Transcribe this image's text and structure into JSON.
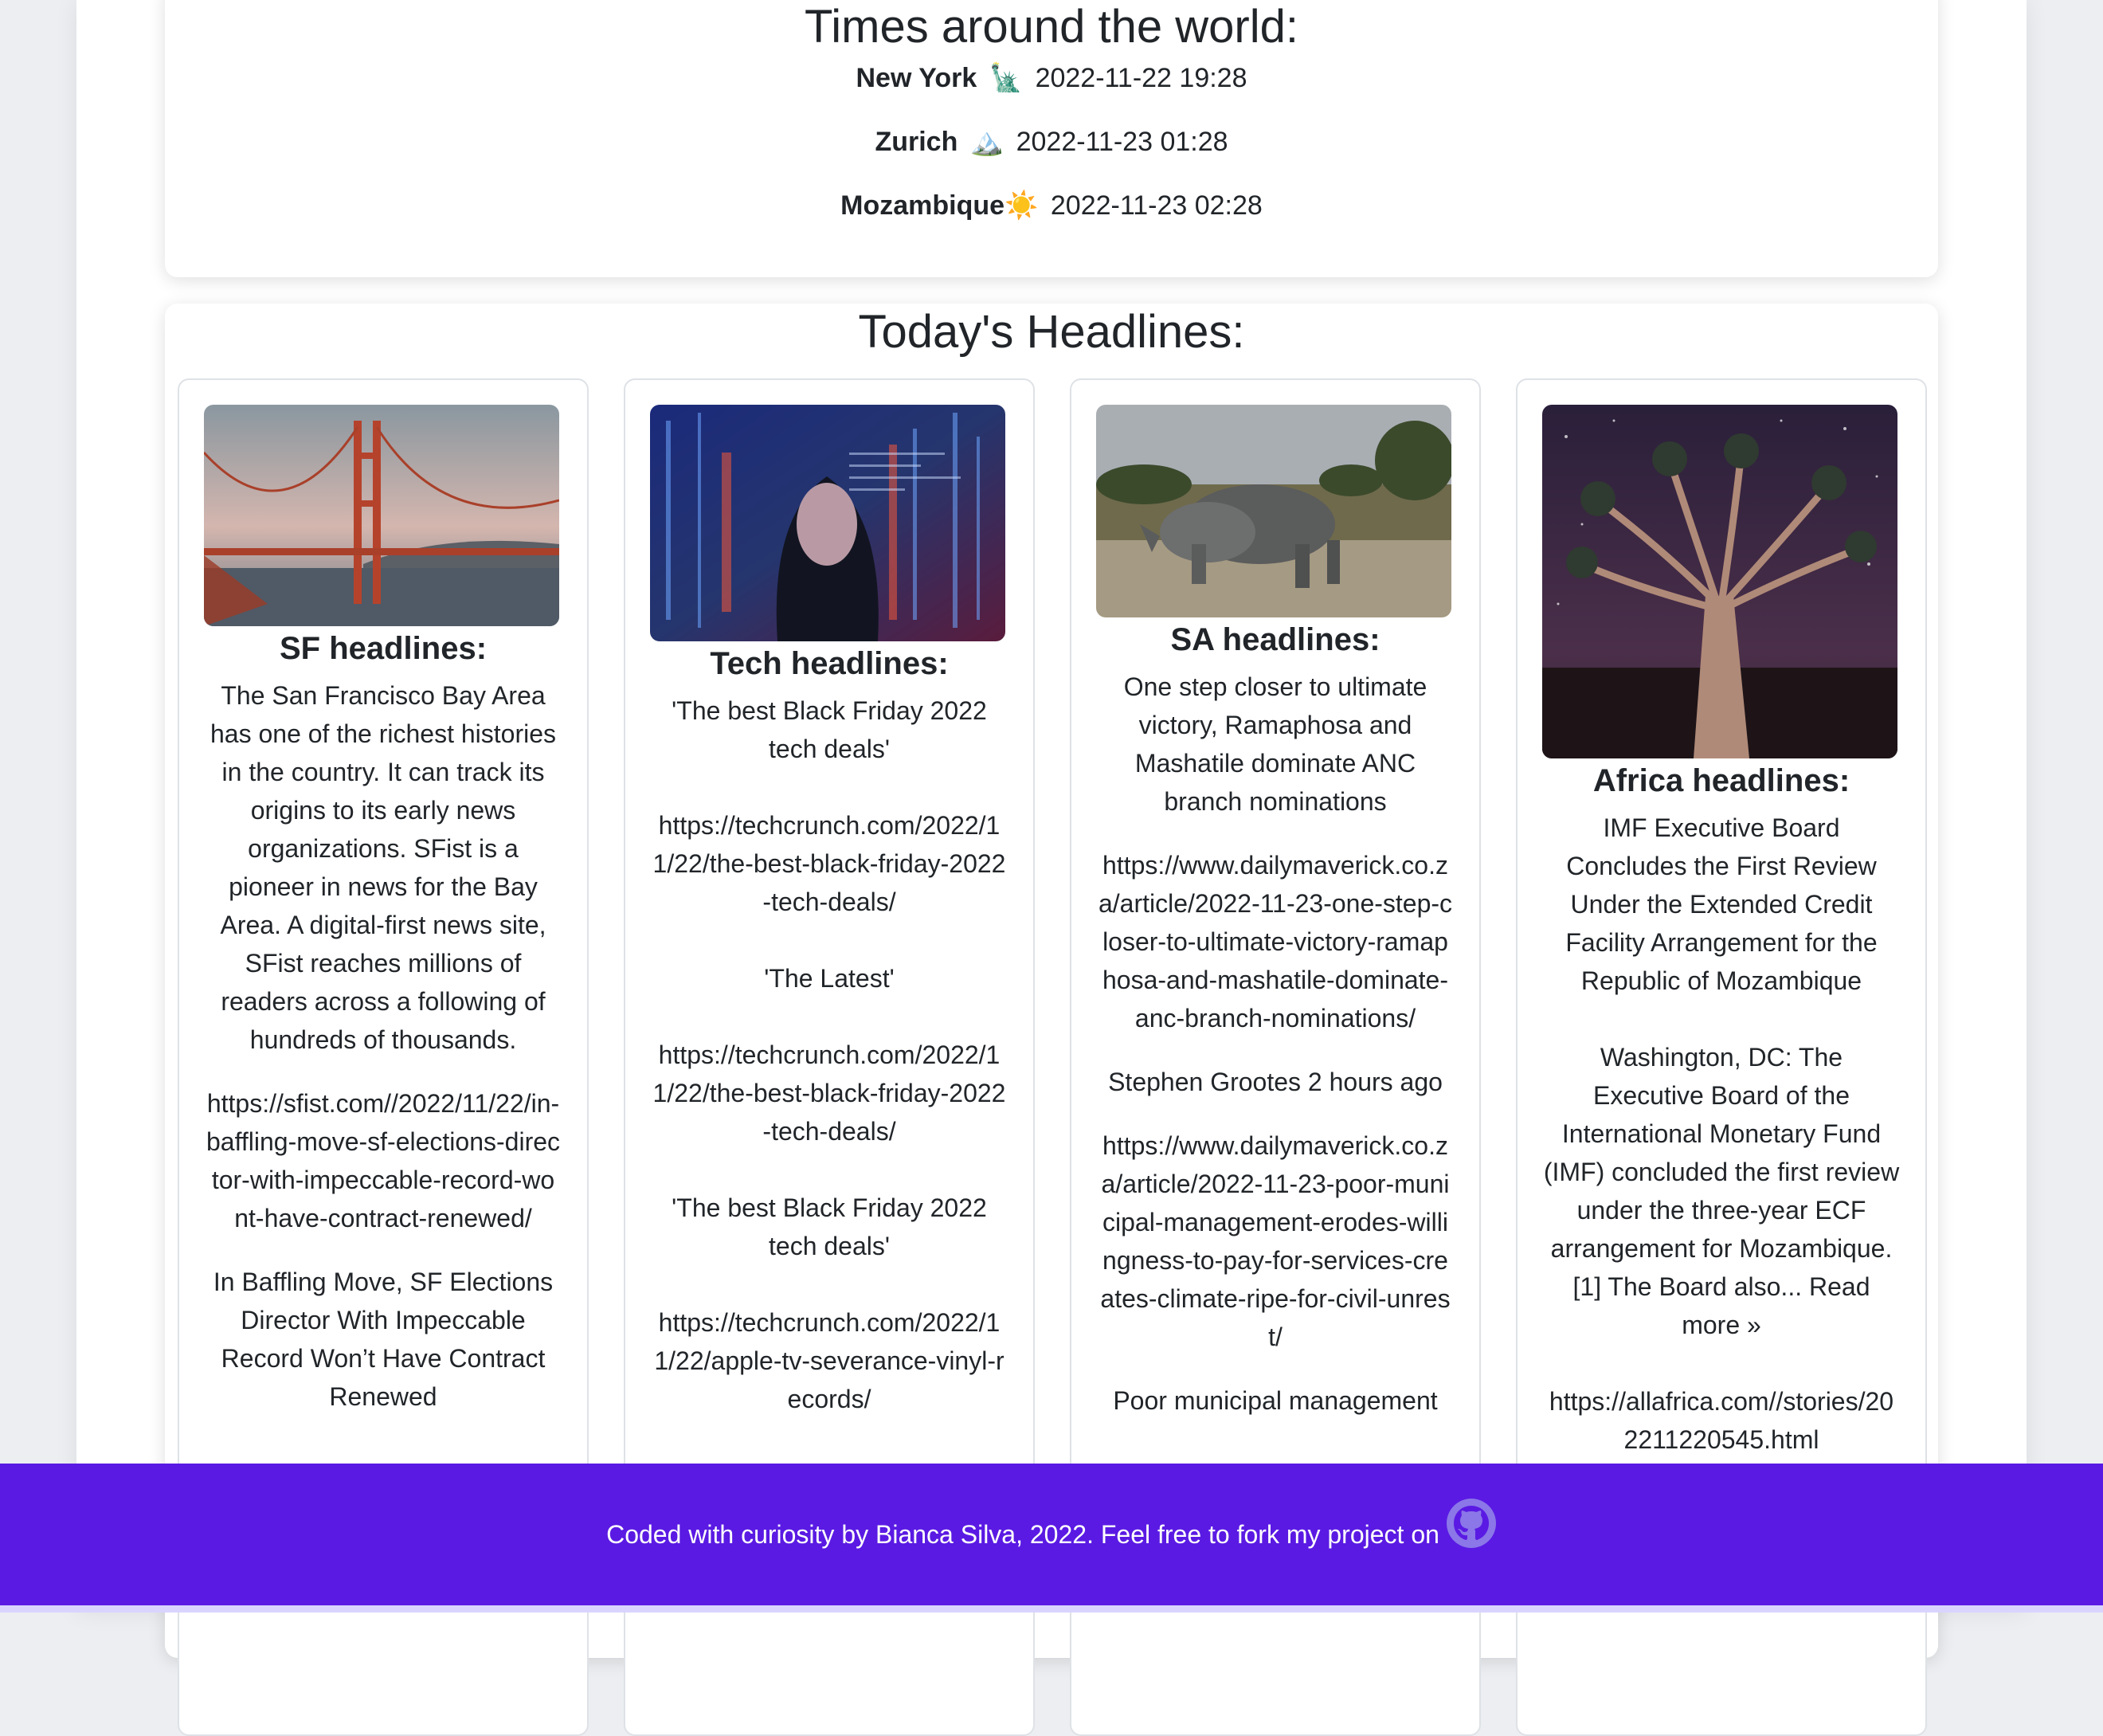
{
  "times": {
    "title": "Times around the world:",
    "rows": [
      {
        "city": "New York",
        "emoji": "🗽",
        "datetime": "2022-11-22 19:28"
      },
      {
        "city": "Zurich",
        "emoji": "🏔️",
        "datetime": "2022-11-23 01:28"
      },
      {
        "city": "Mozambique",
        "emoji": "☀️",
        "datetime": "2022-11-23 02:28"
      }
    ]
  },
  "headlines": {
    "title": "Today's Headlines:",
    "cards": [
      {
        "title": "SF headlines:",
        "image": "golden-gate-bridge-image",
        "paragraphs": [
          "The San Francisco Bay Area has one of the richest histories in the country. It can track its origins to its early news organizations. SFist is a pioneer in news for the Bay Area. A digital-first news site, SFist reaches millions of readers across a following of hundreds of thousands.",
          "https://sfist.com//2022/11/22/in-baffling-move-sf-elections-director-with-impeccable-record-wont-have-contract-renewed/",
          "In Baffling Move, SF Elections Director With Impeccable Record Won’t Have Contract Renewed"
        ]
      },
      {
        "title": "Tech headlines:",
        "image": "tech-person-code-image",
        "paragraphs": [
          "'The best Black Friday 2022 tech deals'",
          "https://techcrunch.com/2022/11/22/the-best-black-friday-2022-tech-deals/",
          "'The Latest'",
          "https://techcrunch.com/2022/11/22/the-best-black-friday-2022-tech-deals/",
          "'The best Black Friday 2022 tech deals'",
          "https://techcrunch.com/2022/11/22/apple-tv-severance-vinyl-records/"
        ]
      },
      {
        "title": "SA headlines:",
        "image": "rhinos-image",
        "paragraphs": [
          "One step closer to ultimate victory, Ramaphosa and Mashatile dominate ANC branch nominations",
          "https://www.dailymaverick.co.za/article/2022-11-23-one-step-closer-to-ultimate-victory-ramaphosa-and-mashatile-dominate-anc-branch-nominations/",
          "Stephen Grootes 2 hours ago",
          "https://www.dailymaverick.co.za/article/2022-11-23-poor-municipal-management-erodes-willingness-to-pay-for-services-creates-climate-ripe-for-civil-unrest/",
          "Poor municipal management"
        ]
      },
      {
        "title": "Africa headlines:",
        "image": "quiver-tree-night-image",
        "paragraphs": [
          "IMF Executive Board Concludes the First Review Under the Extended Credit Facility Arrangement for the Republic of Mozambique",
          "Washington, DC: The Executive Board of the International Monetary Fund (IMF) concluded the first review under the three-year ECF arrangement for Mozambique. [1] The Board also...",
          "https://allafrica.com//stories/202211220545.html"
        ],
        "read_more": "Read more »"
      }
    ]
  },
  "footer": {
    "text": "Coded with curiosity by Bianca Silva, 2022. Feel free to fork my project on",
    "icon": "github-icon"
  },
  "colors": {
    "footer_bg": "#5a1ae3",
    "page_bg": "#eceef1",
    "card_bg": "#ffffff"
  }
}
